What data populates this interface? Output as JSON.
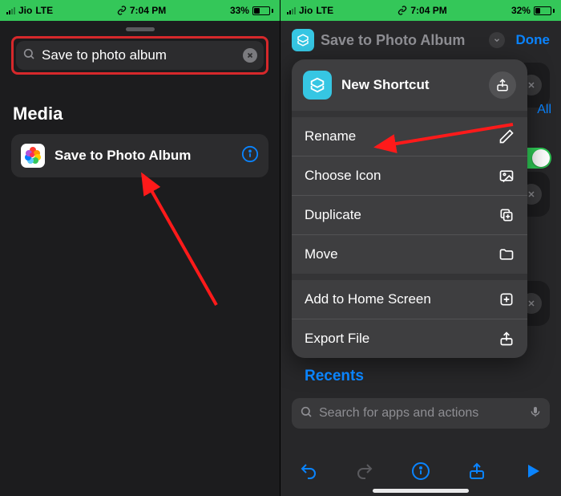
{
  "left": {
    "status": {
      "carrier": "Jio",
      "net": "LTE",
      "time": "7:04 PM",
      "battery": "33%"
    },
    "search_value": "Save to photo album",
    "section": "Media",
    "result_label": "Save to Photo Album"
  },
  "right": {
    "status": {
      "carrier": "Jio",
      "net": "LTE",
      "time": "7:04 PM",
      "battery": "32%"
    },
    "header_title": "Save to Photo Album",
    "done": "Done",
    "all_chip": "All",
    "sheet_title": "New Shortcut",
    "menu": {
      "rename": "Rename",
      "choose_icon": "Choose Icon",
      "duplicate": "Duplicate",
      "move": "Move",
      "add_home": "Add to Home Screen",
      "export": "Export File"
    },
    "recents": "Recents",
    "search_placeholder": "Search for apps and actions"
  }
}
